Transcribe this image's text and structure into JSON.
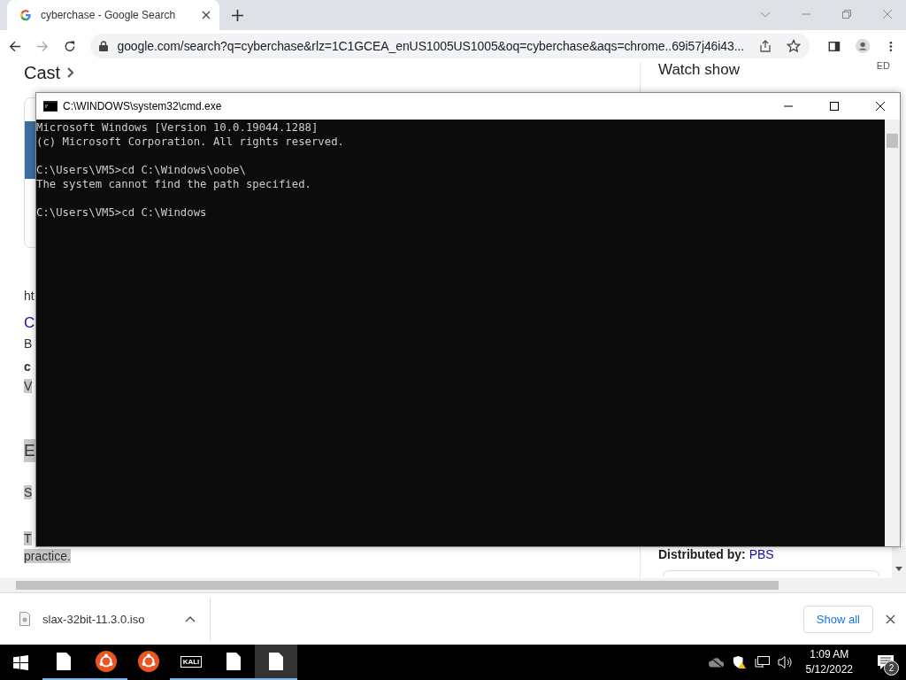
{
  "browser": {
    "tab": {
      "title": "cyberchase - Google Search",
      "selected": true
    },
    "address": "google.com/search?q=cyberchase&rlz=1C1GCEA_enUS1005US1005&oq=cyberchase&aqs=chrome..69i57j46i43...",
    "page": {
      "left": [
        {
          "kind": "heading",
          "text": "Cast"
        },
        {
          "kind": "plain",
          "text": "ht"
        },
        {
          "kind": "link",
          "text": "C"
        },
        {
          "kind": "plain",
          "text": "B"
        },
        {
          "kind": "bold",
          "text": "c"
        },
        {
          "kind": "marked",
          "text": "V"
        },
        {
          "kind": "big",
          "text": "E"
        },
        {
          "kind": "marked",
          "text": "S"
        },
        {
          "kind": "marked",
          "text": "T"
        },
        {
          "kind": "marked",
          "text": "practice."
        }
      ],
      "right": {
        "heading": "Watch show",
        "corner": "ED",
        "label": "Distributed by:",
        "link": "PBS"
      }
    }
  },
  "console": {
    "title": "C:\\WINDOWS\\system32\\cmd.exe",
    "blocks": [
      [
        "Microsoft Windows [Version 10.0.19044.1288]",
        "(c) Microsoft Corporation. All rights reserved."
      ],
      [
        "C:\\Users\\VM5>cd C:\\Windows\\oobe\\",
        "The system cannot find the path specified."
      ],
      [
        "C:\\Users\\VM5>cd C:\\Windows"
      ]
    ]
  },
  "downloads": {
    "file": "slax-32bit-11.3.0.iso",
    "show_all": "Show all"
  },
  "taskbar": {
    "items": [
      {
        "kind": "file",
        "running": true,
        "selected": false
      },
      {
        "kind": "ubuntu",
        "running": true,
        "selected": false
      },
      {
        "kind": "ubuntu",
        "running": false,
        "selected": false
      },
      {
        "kind": "kali",
        "label": "KALI",
        "running": true,
        "selected": false
      },
      {
        "kind": "file",
        "running": true,
        "selected": false
      },
      {
        "kind": "file",
        "running": true,
        "selected": true
      }
    ],
    "time": "1:09 AM",
    "date": "5/12/2022",
    "notifications": "2"
  }
}
